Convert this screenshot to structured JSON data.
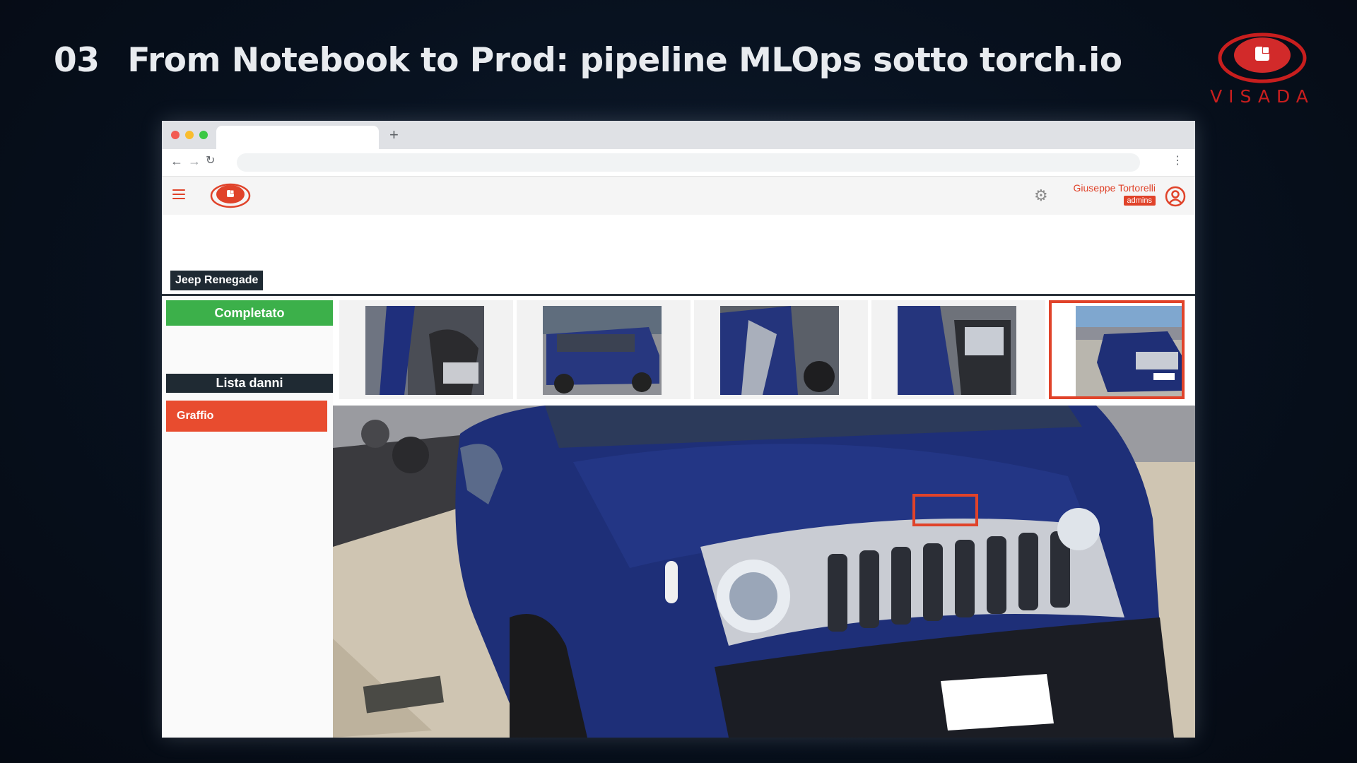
{
  "slide": {
    "number": "03",
    "title": "From Notebook to Prod: pipeline MLOps sotto torch.io",
    "logo_text": "VISADA"
  },
  "browser": {
    "new_tab_label": "+",
    "back_icon": "arrow-left-icon",
    "forward_icon": "arrow-right-icon",
    "reload_icon": "reload-icon",
    "menu_icon": "kebab-menu-icon"
  },
  "app": {
    "user_name": "Giuseppe Tortorelli",
    "user_role": "admins",
    "vehicle_model": "Jeep Renegade",
    "status_label": "Completato",
    "damage_list_title": "Lista danni",
    "damages": [
      "Graffio"
    ],
    "thumbnail_count": 5,
    "selected_thumbnail": 5,
    "colors": {
      "accent": "#e0432a",
      "success": "#3cb04a",
      "dark": "#1f2a33",
      "car_blue": "#1e2f78"
    }
  }
}
